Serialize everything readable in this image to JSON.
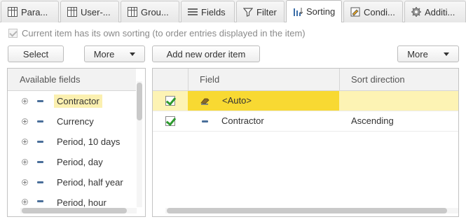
{
  "tabs": [
    {
      "label": "Para...",
      "icon": "table-icon",
      "active": false
    },
    {
      "label": "User-...",
      "icon": "table-icon",
      "active": false
    },
    {
      "label": "Grou...",
      "icon": "table-icon",
      "active": false
    },
    {
      "label": "Fields",
      "icon": "list-icon",
      "active": false
    },
    {
      "label": "Filter",
      "icon": "filter-icon",
      "active": false
    },
    {
      "label": "Sorting",
      "icon": "sort-icon",
      "active": true
    },
    {
      "label": "Condi...",
      "icon": "conditional-icon",
      "active": false
    },
    {
      "label": "Additi...",
      "icon": "gear-icon",
      "active": false
    }
  ],
  "own_sorting": {
    "label": "Current item has its own sorting (to order entries displayed in the item)",
    "checked": true,
    "disabled": true
  },
  "left_toolbar": {
    "select_label": "Select",
    "more_label": "More"
  },
  "right_toolbar": {
    "add_label": "Add new order item",
    "more_label": "More"
  },
  "available_fields": {
    "header": "Available fields",
    "items": [
      {
        "label": "Contractor",
        "selected": true
      },
      {
        "label": "Currency",
        "selected": false
      },
      {
        "label": "Period, 10 days",
        "selected": false
      },
      {
        "label": "Period, day",
        "selected": false
      },
      {
        "label": "Period, half year",
        "selected": false
      },
      {
        "label": "Period, hour",
        "selected": false
      }
    ]
  },
  "order_table": {
    "columns": [
      "Field",
      "Sort direction"
    ],
    "rows": [
      {
        "checked": true,
        "field": "<Auto>",
        "direction": "",
        "selected": true,
        "icon": "auto-icon"
      },
      {
        "checked": true,
        "field": "Contractor",
        "direction": "Ascending",
        "selected": false,
        "icon": "field-icon"
      }
    ]
  },
  "colors": {
    "selection_strong": "#f8d932",
    "selection_light": "#fdf3b4",
    "checkmark": "#2e9a2e"
  }
}
